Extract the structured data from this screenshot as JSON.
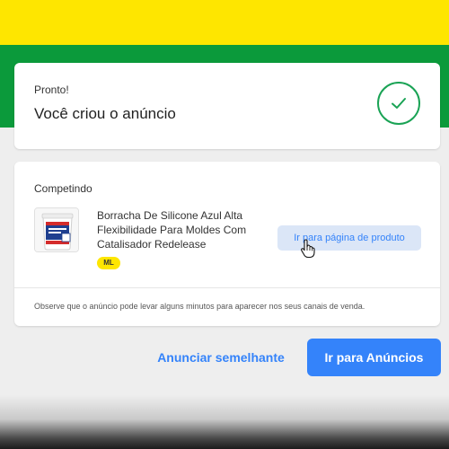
{
  "success": {
    "status": "Pronto!",
    "title": "Você criou o anúncio",
    "icon": "check-icon",
    "accent": "#1aa355"
  },
  "competing": {
    "section_title": "Competindo",
    "product": {
      "title": "Borracha De Silicone Azul Alta Flexibilidade Para Moldes Com Catalisador Redelease",
      "badge": "ML",
      "thumbnail_icon": "product-bucket-image"
    },
    "product_link_label": "Ir para página de produto",
    "note": "Observe que o anúncio pode levar alguns minutos para aparecer nos seus canais de venda."
  },
  "actions": {
    "similar_label": "Anunciar semelhante",
    "go_ads_label": "Ir para Anúncios"
  },
  "colors": {
    "brand_yellow": "#fee600",
    "brand_green": "#0b9a3b",
    "primary_blue": "#3483fa"
  }
}
